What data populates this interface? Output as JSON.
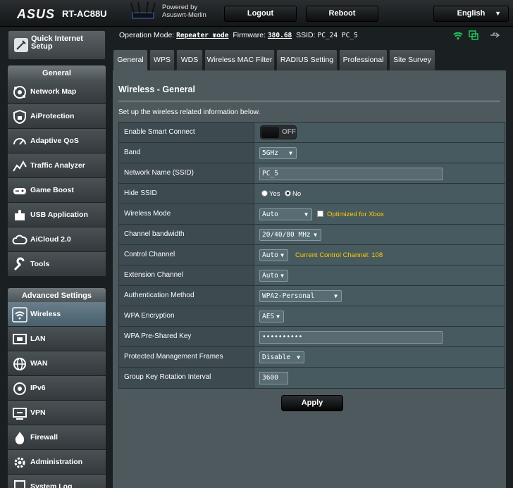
{
  "header": {
    "logo": "ASUS",
    "model": "RT-AC88U",
    "powered_line1": "Powered by",
    "powered_line2": "Asuswrt-Merlin",
    "logout_label": "Logout",
    "reboot_label": "Reboot",
    "language": "English"
  },
  "sidebar": {
    "quick_setup_line1": "Quick Internet",
    "quick_setup_line2": "Setup",
    "general_heading": "General",
    "general_items": [
      {
        "label": "Network Map",
        "icon": "network-map-icon"
      },
      {
        "label": "AiProtection",
        "icon": "shield-lock-icon"
      },
      {
        "label": "Adaptive QoS",
        "icon": "gauge-icon"
      },
      {
        "label": "Traffic Analyzer",
        "icon": "chart-icon"
      },
      {
        "label": "Game Boost",
        "icon": "gamepad-icon"
      },
      {
        "label": "USB Application",
        "icon": "puzzle-icon"
      },
      {
        "label": "AiCloud 2.0",
        "icon": "cloud-icon"
      },
      {
        "label": "Tools",
        "icon": "wrench-icon"
      }
    ],
    "advanced_heading": "Advanced Settings",
    "advanced_items": [
      {
        "label": "Wireless",
        "icon": "wifi-icon",
        "active": true
      },
      {
        "label": "LAN",
        "icon": "lan-icon"
      },
      {
        "label": "WAN",
        "icon": "globe-icon"
      },
      {
        "label": "IPv6",
        "icon": "ipv6-icon"
      },
      {
        "label": "VPN",
        "icon": "vpn-icon"
      },
      {
        "label": "Firewall",
        "icon": "firewall-icon"
      },
      {
        "label": "Administration",
        "icon": "admin-gear-icon"
      },
      {
        "label": "System Log",
        "icon": "log-icon"
      }
    ]
  },
  "status": {
    "mode_label": "Operation Mode:",
    "mode_value": "Repeater mode",
    "firmware_label": "Firmware:",
    "firmware_value": "380.68",
    "ssid_label": "SSID:",
    "ssid_1": "PC_24",
    "ssid_2": "PC_5"
  },
  "tabs": [
    {
      "label": "General",
      "active": true
    },
    {
      "label": "WPS"
    },
    {
      "label": "WDS"
    },
    {
      "label": "Wireless MAC Filter"
    },
    {
      "label": "RADIUS Setting"
    },
    {
      "label": "Professional"
    },
    {
      "label": "Site Survey"
    }
  ],
  "page": {
    "title": "Wireless - General",
    "description": "Set up the wireless related information below."
  },
  "form": {
    "smart_connect": {
      "label": "Enable Smart Connect",
      "state": "OFF"
    },
    "band": {
      "label": "Band",
      "value": "5GHz"
    },
    "ssid": {
      "label": "Network Name (SSID)",
      "value": "PC_5"
    },
    "hide_ssid": {
      "label": "Hide SSID",
      "yes": "Yes",
      "no": "No",
      "selected": "No"
    },
    "wireless_mode": {
      "label": "Wireless Mode",
      "value": "Auto",
      "xbox_label": "Optimized for Xbox"
    },
    "channel_bandwidth": {
      "label": "Channel bandwidth",
      "value": "20/40/80 MHz"
    },
    "control_channel": {
      "label": "Control Channel",
      "value": "Auto",
      "current": "Current Control Channel: 108"
    },
    "extension_channel": {
      "label": "Extension Channel",
      "value": "Auto"
    },
    "auth_method": {
      "label": "Authentication Method",
      "value": "WPA2-Personal"
    },
    "wpa_encryption": {
      "label": "WPA Encryption",
      "value": "AES"
    },
    "psk": {
      "label": "WPA Pre-Shared Key",
      "value": "••••••••••"
    },
    "pmf": {
      "label": "Protected Management Frames",
      "value": "Disable"
    },
    "group_key": {
      "label": "Group Key Rotation Interval",
      "value": "3600"
    }
  },
  "apply_label": "Apply",
  "colors": {
    "accent_yellow": "#ffcc00",
    "panel_bg": "#4d595d",
    "status_green": "#22c55e"
  }
}
